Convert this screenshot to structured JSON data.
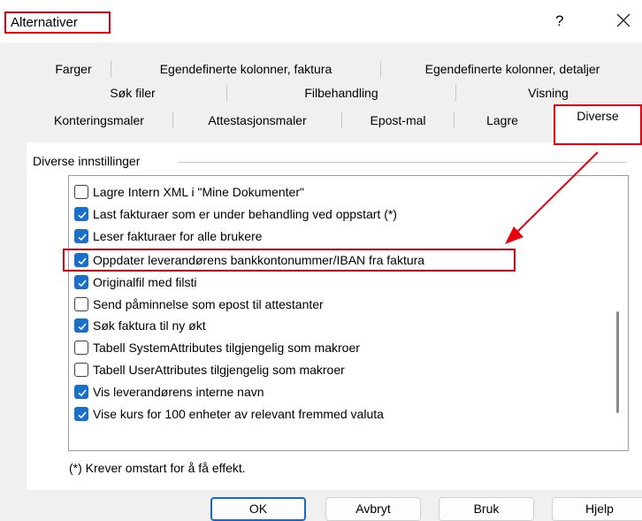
{
  "window": {
    "title": "Alternativer",
    "help_label": "?",
    "close_icon": "close-icon"
  },
  "tabs": {
    "row1": [
      "Farger",
      "Egendefinerte kolonner, faktura",
      "Egendefinerte kolonner, detaljer"
    ],
    "row2": [
      "Søk filer",
      "Filbehandling",
      "Visning"
    ],
    "row3": [
      "Konteringsmaler",
      "Attestasjonsmaler",
      "Epost-mal",
      "Lagre",
      "Diverse"
    ],
    "active": "Diverse"
  },
  "group": {
    "label": "Diverse innstillinger",
    "items": [
      {
        "label": "Lagre Intern XML i \"Mine Dokumenter\"",
        "checked": false
      },
      {
        "label": "Last fakturaer som er under behandling ved oppstart (*)",
        "checked": true
      },
      {
        "label": "Leser fakturaer for alle brukere",
        "checked": true
      },
      {
        "label": "Oppdater leverandørens bankkontonummer/IBAN fra faktura",
        "checked": true
      },
      {
        "label": "Originalfil med filsti",
        "checked": true
      },
      {
        "label": "Send påminnelse som epost til attestanter",
        "checked": false
      },
      {
        "label": "Søk faktura til ny økt",
        "checked": true
      },
      {
        "label": "Tabell SystemAttributes tilgjengelig som makroer",
        "checked": false
      },
      {
        "label": "Tabell UserAttributes tilgjengelig som makroer",
        "checked": false
      },
      {
        "label": "Vis leverandørens interne navn",
        "checked": true
      },
      {
        "label": "Vise kurs for 100 enheter av relevant fremmed valuta",
        "checked": true
      }
    ]
  },
  "note": "(*) Krever omstart for å få effekt.",
  "buttons": {
    "ok": "OK",
    "cancel": "Avbryt",
    "apply": "Bruk",
    "help": "Hjelp"
  },
  "colors": {
    "accent": "#1a6fc9",
    "annotation": "#e8000e"
  }
}
